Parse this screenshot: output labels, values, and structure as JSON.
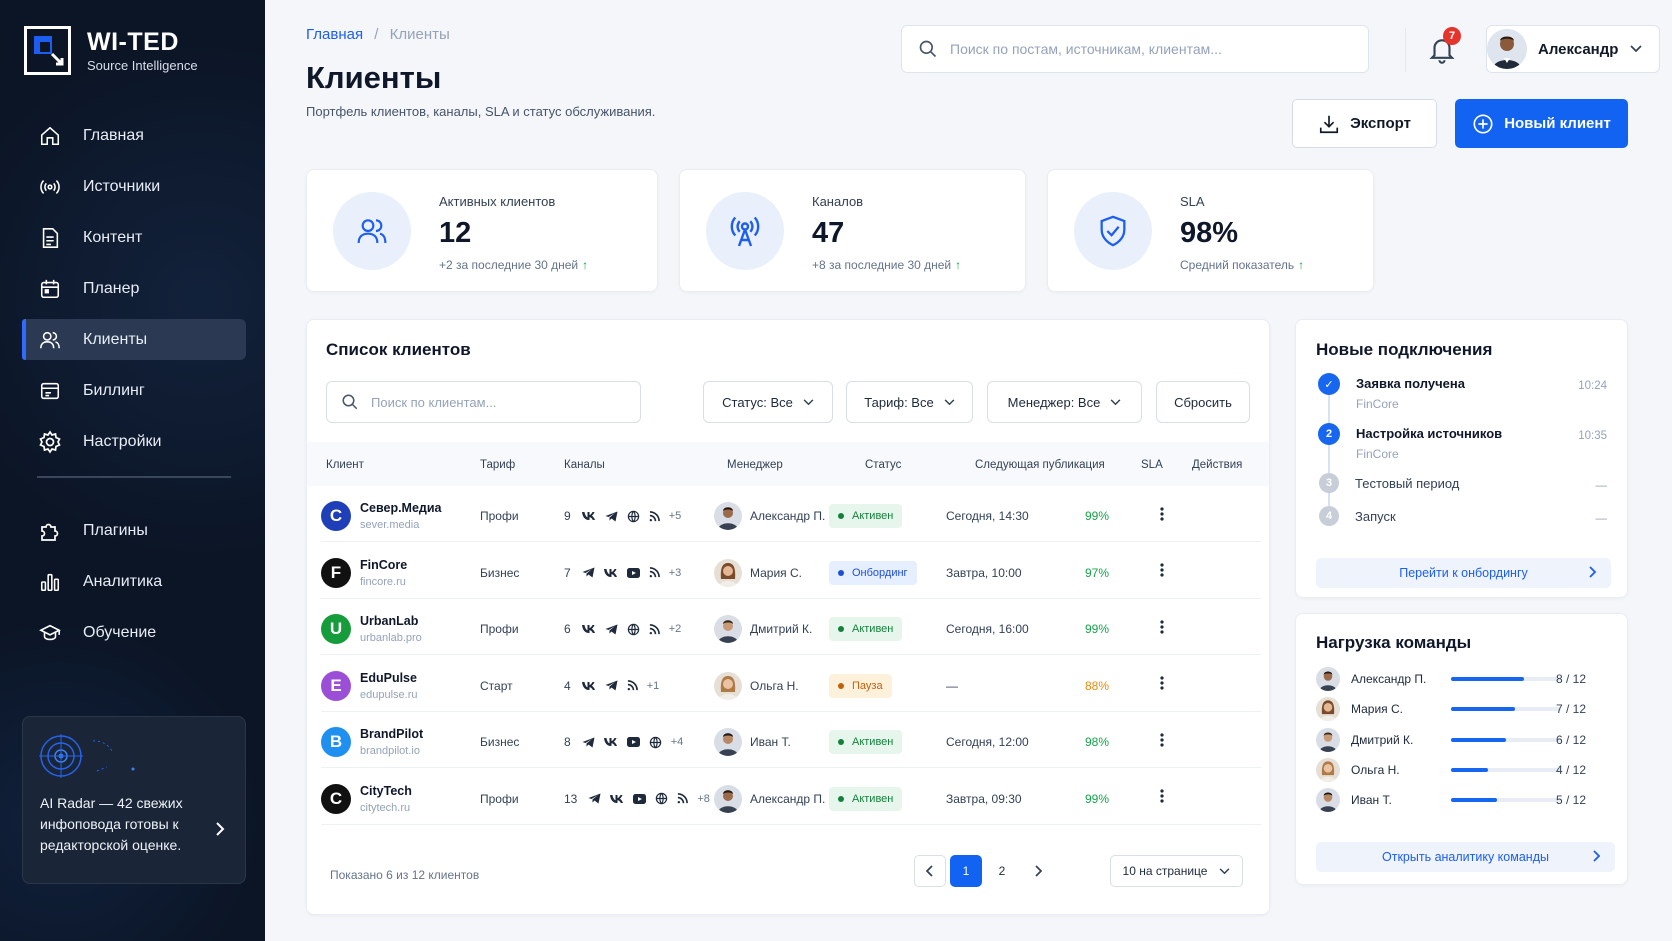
{
  "brand": {
    "title": "WI-TED",
    "subtitle": "Source Intelligence"
  },
  "sidebar": {
    "items": [
      {
        "label": "Главная",
        "icon": "home-icon"
      },
      {
        "label": "Источники",
        "icon": "broadcast-icon"
      },
      {
        "label": "Контент",
        "icon": "document-icon"
      },
      {
        "label": "Планер",
        "icon": "calendar-icon"
      },
      {
        "label": "Клиенты",
        "icon": "users-icon",
        "active": true
      },
      {
        "label": "Биллинг",
        "icon": "billing-icon"
      },
      {
        "label": "Настройки",
        "icon": "gear-icon"
      }
    ],
    "secondary": [
      {
        "label": "Плагины",
        "icon": "puzzle-icon"
      },
      {
        "label": "Аналитика",
        "icon": "bar-chart-icon"
      },
      {
        "label": "Обучение",
        "icon": "graduation-icon"
      }
    ],
    "ai_card": {
      "text": "AI Radar — 42 свежих инфоповода готовы к редакторской оценке."
    }
  },
  "header": {
    "breadcrumb": {
      "home": "Главная",
      "separator": "/",
      "current": "Клиенты"
    },
    "title": "Клиенты",
    "subtitle": "Портфель клиентов, каналы, SLA и статус обслуживания.",
    "search_placeholder": "Поиск по постам, источникам, клиентам...",
    "notifications_count": "7",
    "user_name": "Александр",
    "export_label": "Экспорт",
    "new_client_label": "Новый клиент"
  },
  "stats": [
    {
      "label": "Активных клиентов",
      "value": "12",
      "foot": "+2 за последние 30 дней",
      "icon": "users-icon"
    },
    {
      "label": "Каналов",
      "value": "47",
      "foot": "+8 за последние 30 дней",
      "icon": "antenna-icon"
    },
    {
      "label": "SLA",
      "value": "98%",
      "foot": "Средний показатель",
      "icon": "shield-check-icon"
    }
  ],
  "clients": {
    "title": "Список клиентов",
    "search_placeholder": "Поиск по клиентам...",
    "filters": {
      "status": "Статус: Все",
      "tariff": "Тариф: Все",
      "manager": "Менеджер: Все",
      "reset": "Сбросить"
    },
    "columns": [
      "Клиент",
      "Тариф",
      "Каналы",
      "Менеджер",
      "Статус",
      "Следующая публикация",
      "SLA",
      "Действия"
    ],
    "rows": [
      {
        "letter": "С",
        "color": "#1f3fb8",
        "name": "Север.Медиа",
        "domain": "sever.media",
        "tariff": "Профи",
        "channels": "9",
        "icons": [
          "vk",
          "tg",
          "web",
          "rss"
        ],
        "more": "+5",
        "manager": "Александр П.",
        "status": "Активен",
        "status_kind": "active",
        "next": "Сегодня, 14:30",
        "sla": "99%",
        "sla_color": "#16a34a"
      },
      {
        "letter": "F",
        "color": "#111111",
        "name": "FinCore",
        "domain": "fincore.ru",
        "tariff": "Бизнес",
        "channels": "7",
        "icons": [
          "tg",
          "vk",
          "yt",
          "rss"
        ],
        "more": "+3",
        "manager": "Мария С.",
        "status": "Онбординг",
        "status_kind": "onb",
        "next": "Завтра, 10:00",
        "sla": "97%",
        "sla_color": "#16a34a"
      },
      {
        "letter": "U",
        "color": "#169c3a",
        "name": "UrbanLab",
        "domain": "urbanlab.pro",
        "tariff": "Профи",
        "channels": "6",
        "icons": [
          "vk",
          "tg",
          "web",
          "rss"
        ],
        "more": "+2",
        "manager": "Дмитрий К.",
        "status": "Активен",
        "status_kind": "active",
        "next": "Сегодня, 16:00",
        "sla": "99%",
        "sla_color": "#16a34a"
      },
      {
        "letter": "E",
        "color": "#9b4fd6",
        "name": "EduPulse",
        "domain": "edupulse.ru",
        "tariff": "Старт",
        "channels": "4",
        "icons": [
          "vk",
          "tg",
          "rss"
        ],
        "more": "+1",
        "manager": "Ольга Н.",
        "status": "Пауза",
        "status_kind": "pause",
        "next": "—",
        "sla": "88%",
        "sla_color": "#ea8a0e"
      },
      {
        "letter": "B",
        "color": "#1f8ff0",
        "name": "BrandPilot",
        "domain": "brandpilot.io",
        "tariff": "Бизнес",
        "channels": "8",
        "icons": [
          "tg",
          "vk",
          "yt",
          "web"
        ],
        "more": "+4",
        "manager": "Иван Т.",
        "status": "Активен",
        "status_kind": "active",
        "next": "Сегодня, 12:00",
        "sla": "98%",
        "sla_color": "#16a34a"
      },
      {
        "letter": "C",
        "color": "#111111",
        "name": "CityTech",
        "domain": "citytech.ru",
        "tariff": "Профи",
        "channels": "13",
        "icons": [
          "tg",
          "vk",
          "yt",
          "web",
          "rss"
        ],
        "more": "+8",
        "manager": "Александр П.",
        "status": "Активен",
        "status_kind": "active",
        "next": "Завтра, 09:30",
        "sla": "99%",
        "sla_color": "#16a34a"
      }
    ],
    "shown_text": "Показано 6 из 12 клиентов",
    "pages": [
      "1",
      "2"
    ],
    "per_page": "10 на странице"
  },
  "onboarding": {
    "title": "Новые подключения",
    "steps": [
      {
        "n": "✓",
        "title": "Заявка получена",
        "sub": "FinCore",
        "time": "10:24",
        "state": "done"
      },
      {
        "n": "2",
        "title": "Настройка источников",
        "sub": "FinCore",
        "time": "10:35",
        "state": "current"
      },
      {
        "n": "3",
        "title": "Тестовый период",
        "sub": "",
        "time": "—",
        "state": "pending"
      },
      {
        "n": "4",
        "title": "Запуск",
        "sub": "",
        "time": "—",
        "state": "pending"
      }
    ],
    "link": "Перейти к онбордингу"
  },
  "team": {
    "title": "Нагрузка команды",
    "members": [
      {
        "name": "Александр П.",
        "load": "8 / 12",
        "fraction": 0.667
      },
      {
        "name": "Мария С.",
        "load": "7 / 12",
        "fraction": 0.583
      },
      {
        "name": "Дмитрий К.",
        "load": "6 / 12",
        "fraction": 0.5
      },
      {
        "name": "Ольга Н.",
        "load": "4 / 12",
        "fraction": 0.333
      },
      {
        "name": "Иван Т.",
        "load": "5 / 12",
        "fraction": 0.417
      }
    ],
    "link": "Открыть аналитику команды"
  }
}
